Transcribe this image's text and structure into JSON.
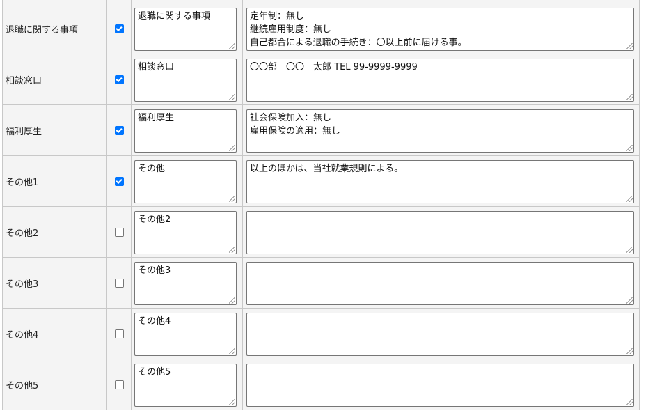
{
  "rows": [
    {
      "label": "退職に関する事項",
      "checked": true,
      "title": "退職に関する事項",
      "body": "定年制：無し\n継続雇用制度：無し\n自己都合による退職の手続き：〇以上前に届ける事。"
    },
    {
      "label": "相談窓口",
      "checked": true,
      "title": "相談窓口",
      "body": "〇〇部　〇〇　太郎 TEL 99-9999-9999"
    },
    {
      "label": "福利厚生",
      "checked": true,
      "title": "福利厚生",
      "body": "社会保険加入：無し\n雇用保険の適用：無し"
    },
    {
      "label": "その他1",
      "checked": true,
      "title": "その他",
      "body": "以上のほかは、当社就業規則による。"
    },
    {
      "label": "その他2",
      "checked": false,
      "title": "その他2",
      "body": ""
    },
    {
      "label": "その他3",
      "checked": false,
      "title": "その他3",
      "body": ""
    },
    {
      "label": "その他4",
      "checked": false,
      "title": "その他4",
      "body": ""
    },
    {
      "label": "その他5",
      "checked": false,
      "title": "その他5",
      "body": ""
    }
  ],
  "colors": {
    "checkbox_checked": "#0075ff",
    "border": "#c8c8c8",
    "cell_bg": "#f4f4f4"
  }
}
